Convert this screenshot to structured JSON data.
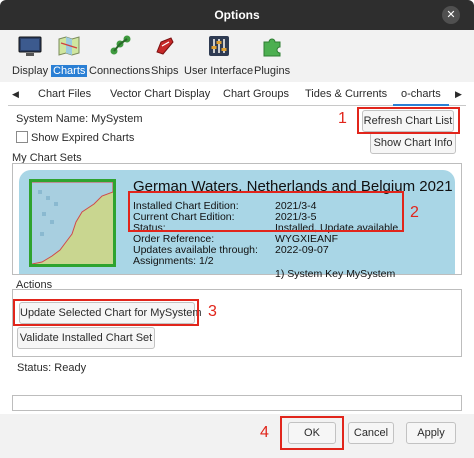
{
  "window": {
    "title": "Options",
    "close_glyph": "✕"
  },
  "toolbar": {
    "items": [
      {
        "label": "Display",
        "icon": "monitor-icon"
      },
      {
        "label": "Charts",
        "icon": "chart-icon"
      },
      {
        "label": "Connections",
        "icon": "connections-icon"
      },
      {
        "label": "Ships",
        "icon": "ship-icon"
      },
      {
        "label": "User Interface",
        "icon": "sliders-icon"
      },
      {
        "label": "Plugins",
        "icon": "puzzle-icon"
      }
    ],
    "active": "Charts"
  },
  "tabs": {
    "left_arrow": "◀",
    "right_arrow": "▶",
    "items": [
      "Chart Files",
      "Vector Chart Display",
      "Chart Groups",
      "Tides & Currents",
      "o-charts"
    ],
    "active": "o-charts"
  },
  "panel": {
    "system_name": "System Name: MySystem",
    "show_expired": "Show Expired Charts",
    "refresh_button": "Refresh Chart List",
    "show_chart_info_button": "Show Chart Info",
    "my_chart_sets_label": "My Chart Sets"
  },
  "chart_set": {
    "title": "German Waters, Netherlands and Belgium 2021",
    "rows": [
      {
        "key": "Installed Chart Edition:",
        "value": "2021/3-4"
      },
      {
        "key": "Current Chart Edition:",
        "value": "2021/3-5"
      },
      {
        "key": "Status:",
        "value": "Installed, Update available."
      },
      {
        "key": "Order Reference:",
        "value": "WYGXIEANF"
      },
      {
        "key": "Updates available through:",
        "value": "2022-09-07"
      },
      {
        "key": "Assignments:",
        "value": "1/2"
      }
    ],
    "assignment_line": "1) System Key   MySystem"
  },
  "actions": {
    "label": "Actions",
    "update_button": "Update Selected Chart for MySystem",
    "validate_button": "Validate Installed Chart Set"
  },
  "status_text": "Status: Ready",
  "footer": {
    "ok": "OK",
    "cancel": "Cancel",
    "apply": "Apply"
  },
  "annotations": {
    "n1": "1",
    "n2": "2",
    "n3": "3",
    "n4": "4"
  },
  "colors": {
    "annotation_red": "#e1251b",
    "accent": "#2a7fd4",
    "card_bg": "#a9d6e6",
    "map_border": "#2fa32f"
  }
}
